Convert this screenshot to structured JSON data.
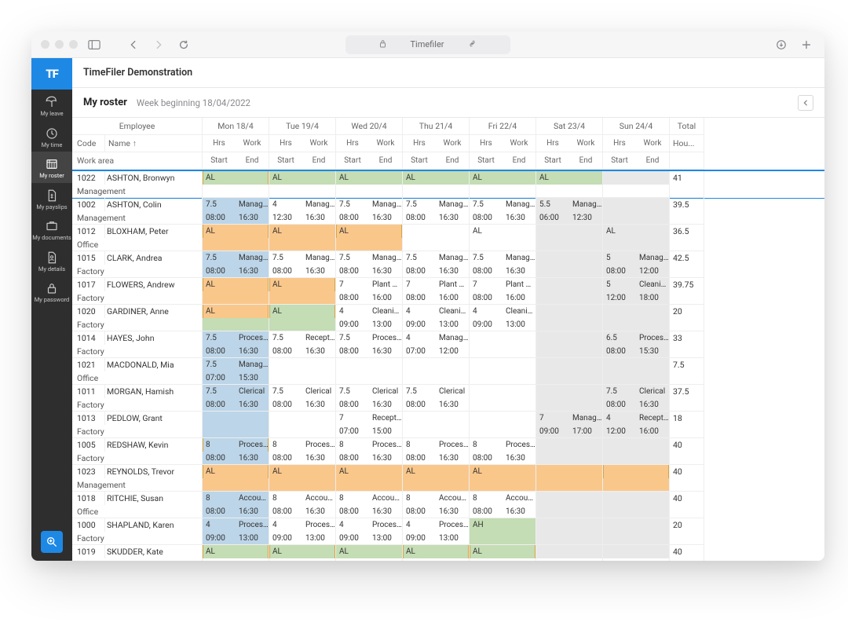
{
  "browser": {
    "title": "Timefiler"
  },
  "app_title": "TimeFiler Demonstration",
  "logo": "TF",
  "sidebar": {
    "items": [
      {
        "label": "My leave"
      },
      {
        "label": "My time"
      },
      {
        "label": "My roster"
      },
      {
        "label": "My payslips"
      },
      {
        "label": "My documents"
      },
      {
        "label": "My details"
      },
      {
        "label": "My password"
      }
    ]
  },
  "page": {
    "title": "My roster",
    "subtitle": "Week beginning 18/04/2022"
  },
  "header": {
    "employee": "Employee",
    "code": "Code",
    "name": "Name ↑",
    "work_area": "Work area",
    "hrs": "Hrs",
    "work": "Work",
    "start": "Start",
    "end": "End",
    "total": "Total",
    "hours": "Hou...",
    "days": [
      "Mon 18/4",
      "Tue 19/4",
      "Wed 20/4",
      "Thu 21/4",
      "Fri 22/4",
      "Sat 23/4",
      "Sun 24/4"
    ]
  },
  "rows": [
    {
      "code": "1022",
      "name": "ASHTON, Bronwyn",
      "area": "Management",
      "total": "41",
      "days": [
        {
          "t1a": "AL",
          "c1": "green hl"
        },
        {
          "t1a": "AL",
          "c1": "green"
        },
        {
          "t1a": "AL",
          "c1": "green"
        },
        {
          "t1a": "AL",
          "c1": "green"
        },
        {
          "t1a": "AL",
          "c1": "green"
        },
        {
          "t1a": "AL",
          "c1": "green"
        },
        {
          "c1": "grey"
        }
      ]
    },
    {
      "code": "1002",
      "name": "ASHTON, Colin",
      "area": "Management",
      "total": "39.5",
      "days": [
        {
          "t1a": "7.5",
          "t1b": "Managem...",
          "t2a": "08:00",
          "t2b": "16:30",
          "c1": "blue",
          "c2": "blue"
        },
        {
          "t1a": "4",
          "t1b": "Managem...",
          "t2a": "12:30",
          "t2b": "16:30"
        },
        {
          "t1a": "7.5",
          "t1b": "Managem...",
          "t2a": "08:00",
          "t2b": "16:30"
        },
        {
          "t1a": "7.5",
          "t1b": "Managem...",
          "t2a": "08:00",
          "t2b": "16:30"
        },
        {
          "t1a": "7.5",
          "t1b": "Managem...",
          "t2a": "08:00",
          "t2b": "16:30"
        },
        {
          "t1a": "5.5",
          "t1b": "Managem...",
          "t2a": "06:00",
          "t2b": "12:30",
          "c1": "grey",
          "c2": "grey"
        },
        {
          "c1": "grey",
          "c2": "grey"
        }
      ]
    },
    {
      "code": "1012",
      "name": "BLOXHAM, Peter",
      "area": "Office",
      "total": "36.5",
      "days": [
        {
          "t1a": "AL",
          "c1": "orange hl",
          "c2": "orange"
        },
        {
          "t1a": "AL",
          "c1": "orange",
          "c2": "orange"
        },
        {
          "t1a": "AL",
          "c1": "orange hl",
          "c2": "orange"
        },
        {},
        {
          "t1a": "AL"
        },
        {
          "c1": "grey",
          "c2": "grey"
        },
        {
          "t1a": "AL",
          "c1": "grey",
          "c2": "grey"
        }
      ]
    },
    {
      "code": "1015",
      "name": "CLARK, Andrea",
      "area": "Factory",
      "total": "42.5",
      "days": [
        {
          "t1a": "7.5",
          "t1b": "Managem...",
          "t2a": "08:00",
          "t2b": "16:30",
          "c1": "blue",
          "c2": "blue"
        },
        {
          "t1a": "7.5",
          "t1b": "Managem...",
          "t2a": "08:00",
          "t2b": "16:30"
        },
        {
          "t1a": "7.5",
          "t1b": "Managem...",
          "t2a": "08:00",
          "t2b": "16:30"
        },
        {
          "t1a": "7.5",
          "t1b": "Managem...",
          "t2a": "08:00",
          "t2b": "16:30"
        },
        {
          "t1a": "7.5",
          "t1b": "Managem...",
          "t2a": "08:00",
          "t2b": "16:30"
        },
        {
          "c1": "grey",
          "c2": "grey"
        },
        {
          "t1a": "5",
          "t1b": "Managem...",
          "t2a": "08:00",
          "t2b": "12:00",
          "c1": "grey",
          "c2": "grey"
        }
      ]
    },
    {
      "code": "1017",
      "name": "FLOWERS, Andrew",
      "area": "Factory",
      "total": "39.75",
      "days": [
        {
          "t1a": "AL",
          "c1": "orange hl",
          "c2": "orange"
        },
        {
          "t1a": "AL",
          "c1": "orange hl",
          "c2": "orange"
        },
        {
          "t1a": "7",
          "t1b": "Plant Main...",
          "t2a": "08:00",
          "t2b": "16:00"
        },
        {
          "t1a": "7",
          "t1b": "Plant Main...",
          "t2a": "08:00",
          "t2b": "16:00"
        },
        {
          "t1a": "7",
          "t1b": "Plant Main...",
          "t2a": "08:00",
          "t2b": "16:00"
        },
        {
          "c1": "grey",
          "c2": "grey"
        },
        {
          "t1a": "5",
          "t1b": "Cleaning",
          "t2a": "12:00",
          "t2b": "18:00",
          "c1": "grey",
          "c2": "grey"
        }
      ]
    },
    {
      "code": "1020",
      "name": "GARDINER, Anne",
      "area": "Factory",
      "total": "20",
      "days": [
        {
          "t1a": "AL",
          "c1": "orange hl",
          "c2": "green"
        },
        {
          "t1a": "AL",
          "c1": "green hl",
          "c2": "green"
        },
        {
          "t1a": "4",
          "t1b": "Cleaning",
          "t2a": "09:00",
          "t2b": "13:00"
        },
        {
          "t1a": "4",
          "t1b": "Cleaning",
          "t2a": "09:00",
          "t2b": "13:00"
        },
        {
          "t1a": "4",
          "t1b": "Cleaning",
          "t2a": "09:00",
          "t2b": "13:00"
        },
        {
          "c1": "grey",
          "c2": "grey"
        },
        {
          "c1": "grey",
          "c2": "grey"
        }
      ]
    },
    {
      "code": "1014",
      "name": "HAYES, John",
      "area": "Factory",
      "total": "33",
      "days": [
        {
          "t1a": "7.5",
          "t1b": "Processing",
          "t2a": "08:00",
          "t2b": "16:30",
          "c1": "blue",
          "c2": "blue"
        },
        {
          "t1a": "7.5",
          "t1b": "Reception",
          "t2a": "08:00",
          "t2b": "16:30"
        },
        {
          "t1a": "7.5",
          "t1b": "Processing",
          "t2a": "08:00",
          "t2b": "16:30"
        },
        {
          "t1a": "4",
          "t1b": "Managem...",
          "t2a": "07:00",
          "t2b": "12:00"
        },
        {},
        {
          "c1": "grey",
          "c2": "grey"
        },
        {
          "t1a": "6.5",
          "t1b": "Processing",
          "t2a": "08:00",
          "t2b": "15:30",
          "c1": "grey",
          "c2": "grey"
        }
      ]
    },
    {
      "code": "1021",
      "name": "MACDONALD, Mia",
      "area": "Office",
      "total": "7.5",
      "days": [
        {
          "t1a": "7.5",
          "t1b": "Managem...",
          "t2a": "07:00",
          "t2b": "15:30",
          "c1": "blue",
          "c2": "blue"
        },
        {},
        {},
        {},
        {},
        {
          "c1": "grey",
          "c2": "grey"
        },
        {
          "c1": "grey",
          "c2": "grey"
        }
      ]
    },
    {
      "code": "1011",
      "name": "MORGAN, Hamish",
      "area": "Factory",
      "total": "37.5",
      "days": [
        {
          "t1a": "7.5",
          "t1b": "Clerical",
          "t2a": "08:00",
          "t2b": "16:30",
          "c1": "blue",
          "c2": "blue"
        },
        {
          "t1a": "7.5",
          "t1b": "Clerical",
          "t2a": "08:00",
          "t2b": "16:30"
        },
        {
          "t1a": "7.5",
          "t1b": "Clerical",
          "t2a": "08:00",
          "t2b": "16:30"
        },
        {
          "t1a": "7.5",
          "t1b": "Clerical",
          "t2a": "08:00",
          "t2b": "16:30"
        },
        {},
        {
          "c1": "grey",
          "c2": "grey"
        },
        {
          "t1a": "7.5",
          "t1b": "Clerical",
          "t2a": "08:00",
          "t2b": "16:30",
          "c1": "grey",
          "c2": "grey"
        }
      ]
    },
    {
      "code": "1013",
      "name": "PEDLOW, Grant",
      "area": "Factory",
      "total": "18",
      "days": [
        {
          "c1": "blue",
          "c2": "blue"
        },
        {},
        {
          "t1a": "7",
          "t1b": "Reception",
          "t2a": "07:00",
          "t2b": "15:00"
        },
        {},
        {},
        {
          "t1a": "7",
          "t1b": "Managem...",
          "t2a": "09:00",
          "t2b": "17:00",
          "c1": "grey",
          "c2": "grey"
        },
        {
          "t1a": "4",
          "t1b": "Reception",
          "t2a": "12:00",
          "t2b": "16:00",
          "c1": "grey",
          "c2": "grey"
        }
      ]
    },
    {
      "code": "1005",
      "name": "REDSHAW, Kevin",
      "area": "Factory",
      "total": "40",
      "days": [
        {
          "t1a": "8",
          "t1b": "Processing",
          "t2a": "08:00",
          "t2b": "16:30",
          "c1": "blue hl",
          "c2": "blue"
        },
        {
          "t1a": "8",
          "t1b": "Processing",
          "t2a": "08:00",
          "t2b": "16:30"
        },
        {
          "t1a": "8",
          "t1b": "Processing",
          "t2a": "08:00",
          "t2b": "16:30"
        },
        {
          "t1a": "8",
          "t1b": "Processing",
          "t2a": "08:00",
          "t2b": "16:30"
        },
        {
          "t1a": "8",
          "t1b": "Processing",
          "t2a": "08:00",
          "t2b": "16:30"
        },
        {
          "c1": "grey",
          "c2": "grey"
        },
        {
          "c1": "grey",
          "c2": "grey"
        }
      ]
    },
    {
      "code": "1023",
      "name": "REYNOLDS, Trevor",
      "area": "Management",
      "total": "40",
      "days": [
        {
          "t1a": "AL",
          "c1": "orange hl",
          "c2": "orange"
        },
        {
          "t1a": "AL",
          "c1": "orange",
          "c2": "orange"
        },
        {
          "t1a": "AL",
          "c1": "orange",
          "c2": "orange"
        },
        {
          "t1a": "AL",
          "c1": "orange",
          "c2": "orange"
        },
        {
          "t1a": "AL",
          "c1": "orange",
          "c2": "orange"
        },
        {
          "c1": "orange",
          "c2": "orange"
        },
        {
          "c1": "orange hl",
          "c2": "orange"
        }
      ]
    },
    {
      "code": "1018",
      "name": "RITCHIE, Susan",
      "area": "Office",
      "total": "40",
      "days": [
        {
          "t1a": "8",
          "t1b": "Accounting",
          "t2a": "08:00",
          "t2b": "16:30",
          "c1": "blue",
          "c2": "blue"
        },
        {
          "t1a": "8",
          "t1b": "Accounting",
          "t2a": "08:00",
          "t2b": "16:30"
        },
        {
          "t1a": "8",
          "t1b": "Accounting",
          "t2a": "08:00",
          "t2b": "16:30"
        },
        {
          "t1a": "8",
          "t1b": "Accounting",
          "t2a": "08:00",
          "t2b": "16:30"
        },
        {
          "t1a": "8",
          "t1b": "Accounting",
          "t2a": "08:00",
          "t2b": "16:30"
        },
        {
          "c1": "grey",
          "c2": "grey"
        },
        {
          "c1": "grey",
          "c2": "grey"
        }
      ]
    },
    {
      "code": "1000",
      "name": "SHAPLAND, Karen",
      "area": "Factory",
      "total": "20",
      "days": [
        {
          "t1a": "4",
          "t1b": "Processing",
          "t2a": "09:00",
          "t2b": "13:00",
          "c1": "blue",
          "c2": "blue"
        },
        {
          "t1a": "4",
          "t1b": "Processing",
          "t2a": "09:00",
          "t2b": "13:00"
        },
        {
          "t1a": "4",
          "t1b": "Processing",
          "t2a": "09:00",
          "t2b": "13:00"
        },
        {
          "t1a": "4",
          "t1b": "Processing",
          "t2a": "09:00",
          "t2b": "13:00"
        },
        {
          "t1a": "AH",
          "c1": "green",
          "c2": "green"
        },
        {
          "c1": "grey",
          "c2": "grey"
        },
        {
          "c1": "grey",
          "c2": "grey"
        }
      ]
    },
    {
      "code": "1019",
      "name": "SKUDDER, Kate",
      "area": "",
      "total": "40",
      "days": [
        {
          "t1a": "AL",
          "c1": "green hl"
        },
        {
          "t1a": "AL",
          "c1": "green hl"
        },
        {
          "t1a": "AL",
          "c1": "green"
        },
        {
          "t1a": "AL",
          "c1": "green hl"
        },
        {
          "t1a": "AL",
          "c1": "green hl"
        },
        {
          "c1": "grey"
        },
        {
          "c1": "grey"
        }
      ]
    }
  ]
}
